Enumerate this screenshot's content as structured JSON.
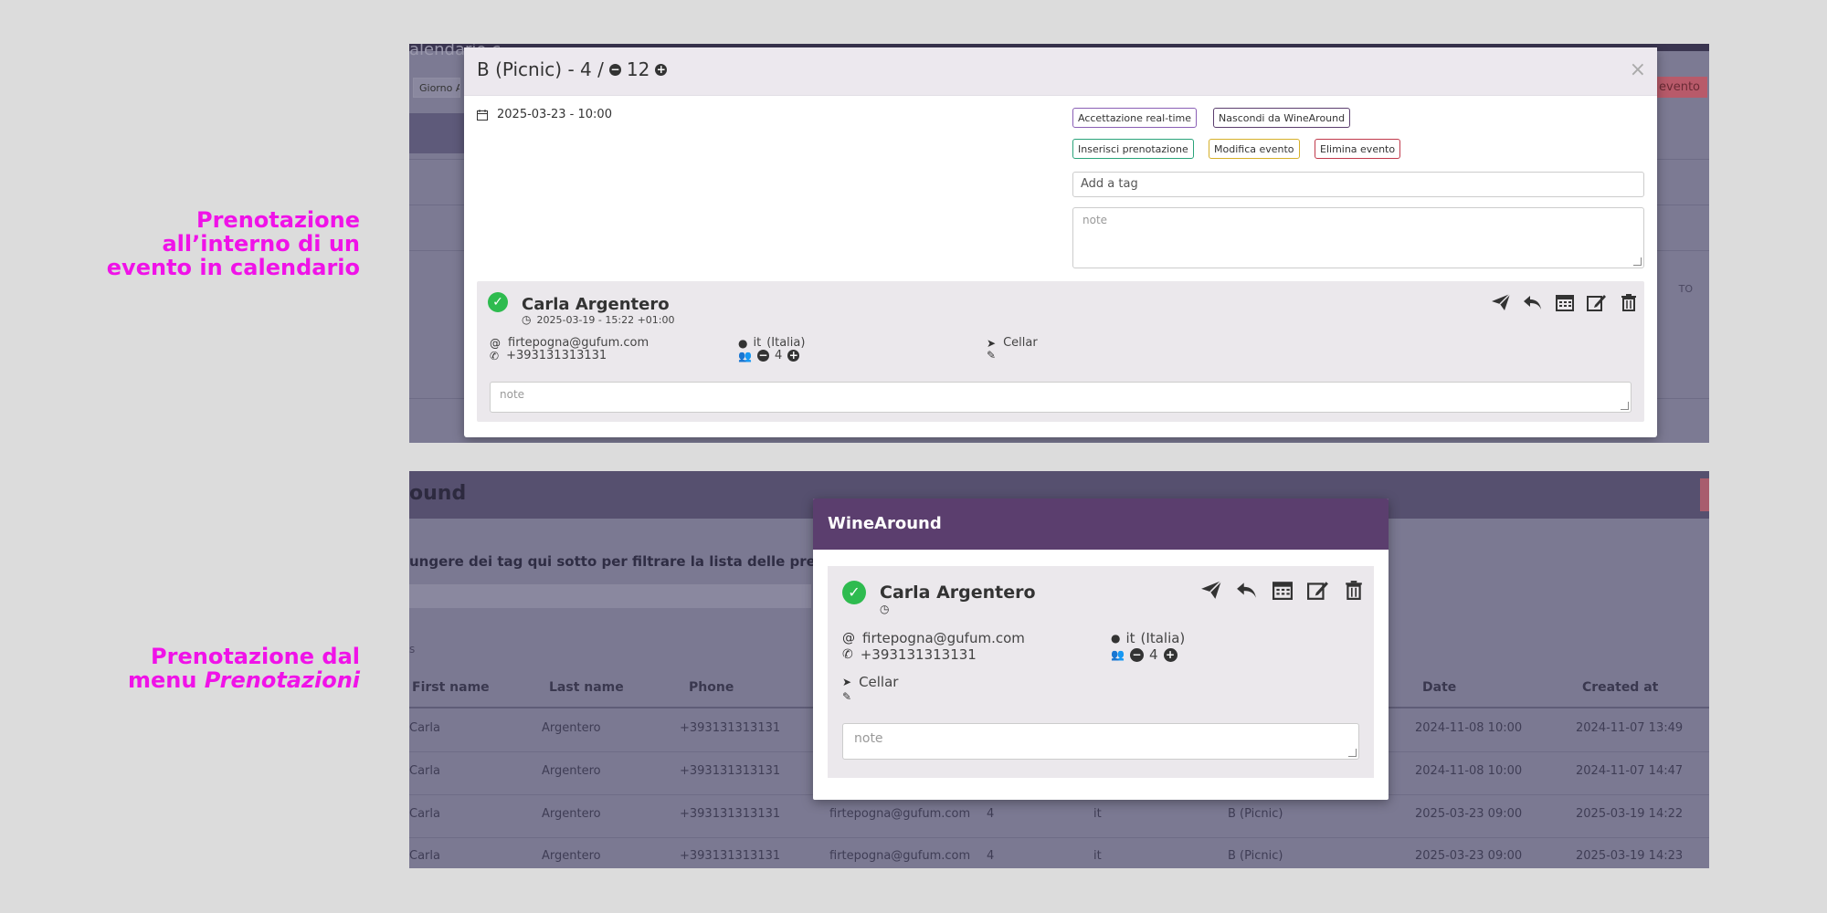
{
  "captions": {
    "top": {
      "line1": "Prenotazione",
      "line2": "all’interno di un",
      "line3": "evento in calendario"
    },
    "bottom": {
      "line1": "Prenotazione dal",
      "line2_prefix": "menu ",
      "line2_italic": "Prenotazioni"
    }
  },
  "shot1": {
    "background": {
      "faded_title": "alendario c",
      "view_select": "Giorno A",
      "right_btn": "evento",
      "right_label": "TO"
    },
    "modal": {
      "title_prefix": "B (Picnic) - 4 /",
      "title_count": "12",
      "close": "×",
      "datetime": "2025-03-23 - 10:00",
      "buttons": {
        "realtime": "Accettazione real-time",
        "hide": "Nascondi da WineAround",
        "insert": "Inserisci prenotazione",
        "edit": "Modifica evento",
        "delete": "Elimina evento"
      },
      "tag_placeholder": "Add a tag",
      "note_placeholder": "note",
      "booking": {
        "name": "Carla Argentero",
        "created": "2025-03-19 - 15:22 +01:00",
        "email": "firtepogna@gufum.com",
        "phone": "+393131313131",
        "language": "it",
        "language_name": "(Italia)",
        "guests": "4",
        "location": "Cellar",
        "note_placeholder": "note"
      }
    }
  },
  "shot2": {
    "background": {
      "header_text": "ound",
      "filter_hint": "ungere dei tag qui sotto per filtrare la lista delle prenotazi",
      "small_label": "s",
      "columns": [
        "First name",
        "Last name",
        "Phone",
        "Date",
        "Created at"
      ],
      "rows": [
        {
          "first": "Carla",
          "last": "Argentero",
          "phone": "+393131313131",
          "email": "",
          "guests": "",
          "lang": "",
          "event": "",
          "date": "2024-11-08 10:00",
          "created": "2024-11-07 13:49"
        },
        {
          "first": "Carla",
          "last": "Argentero",
          "phone": "+393131313131",
          "email": "",
          "guests": "",
          "lang": "",
          "event": "",
          "date": "2024-11-08 10:00",
          "created": "2024-11-07 14:47"
        },
        {
          "first": "Carla",
          "last": "Argentero",
          "phone": "+393131313131",
          "email": "firtepogna@gufum.com",
          "guests": "4",
          "lang": "it",
          "event": "B (Picnic)",
          "date": "2025-03-23 09:00",
          "created": "2025-03-19 14:22"
        },
        {
          "first": "Carla",
          "last": "Argentero",
          "phone": "+393131313131",
          "email": "firtepogna@gufum.com",
          "guests": "4",
          "lang": "it",
          "event": "B (Picnic)",
          "date": "2025-03-23 09:00",
          "created": "2025-03-19 14:23"
        }
      ]
    },
    "modal": {
      "title": "WineAround",
      "booking": {
        "name": "Carla Argentero",
        "email": "firtepogna@gufum.com",
        "phone": "+393131313131",
        "language": "it",
        "language_name": "(Italia)",
        "guests": "4",
        "location": "Cellar",
        "note_placeholder": "note"
      }
    }
  },
  "icons": [
    "calendar-icon",
    "clock-icon",
    "at-icon",
    "phone-icon",
    "globe-icon",
    "users-icon",
    "minus-circle-icon",
    "plus-circle-icon",
    "location-arrow-icon",
    "ticket-icon",
    "check-circle-icon",
    "paper-plane-icon",
    "reply-icon",
    "calendar-alt-icon",
    "edit-icon",
    "trash-icon"
  ],
  "colors": {
    "caption": "#f012e8",
    "modal_header_purple": "#5b3e6e",
    "check_green": "#2ebb4f",
    "btn_realtime": "#8a5fb5",
    "btn_hide": "#5b3e6e",
    "btn_insert": "#2aa37a",
    "btn_edit": "#d6b02a",
    "btn_delete": "#c0394b"
  }
}
